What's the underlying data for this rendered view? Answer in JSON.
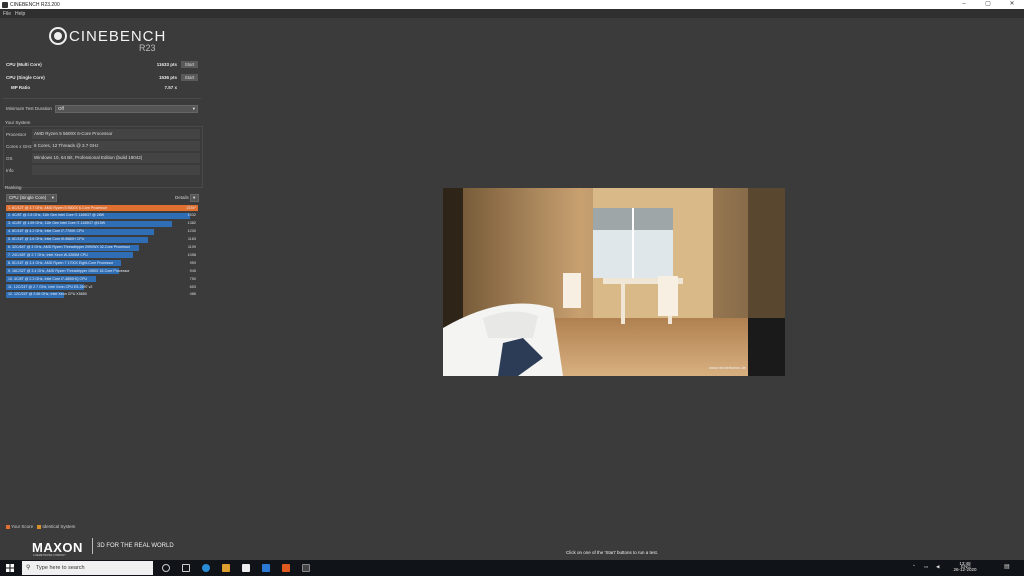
{
  "window": {
    "title": "CINEBENCH R23.200",
    "min": "–",
    "max": "▢",
    "close": "✕"
  },
  "menu": {
    "file": "File",
    "help": "Help"
  },
  "logo": {
    "name": "CINEBENCH",
    "version": "R23"
  },
  "scores": {
    "multi_label": "CPU (Multi Core)",
    "multi_value": "11633 pts",
    "single_label": "CPU (Single Core)",
    "single_value": "1536 pts",
    "ratio_label": "MP Ratio",
    "ratio_value": "7.57 x",
    "start_label": "Start"
  },
  "test_duration": {
    "label": "Minimum Test Duration",
    "value": "Off"
  },
  "system": {
    "heading": "Your System",
    "rows": [
      {
        "label": "Processor",
        "value": "AMD Ryzen 5 5600X 6-Core Processor"
      },
      {
        "label": "Cores x GHz",
        "value": "6 Cores, 12 Threads @ 3.7 GHz"
      },
      {
        "label": "OS",
        "value": "Windows 10, 64 Bit, Professional Edition (build 19042)"
      },
      {
        "label": "Info",
        "value": ""
      }
    ]
  },
  "ranking": {
    "heading": "Ranking",
    "selector": "CPU (Single Core)",
    "details": "Details",
    "max": 1600,
    "rows": [
      {
        "label": "1. 6C/12T @ 3.7 GHz, AMD Ryzen 5 5600X 6-Core Processor",
        "value": "1536*",
        "score": 1536,
        "mine": true
      },
      {
        "label": "2. 4C/8T @ 2.8 GHz, 11th Gen Intel Core i7-1165G7 @ 28W",
        "value": "1532",
        "score": 1532
      },
      {
        "label": "3. 4C/8T @ 1.69 GHz, 11th Gen Intel Core i7-1165G7 @15W",
        "value": "1382",
        "score": 1382
      },
      {
        "label": "4. 8C/16T @ 4.2 GHz, Intel Core i7-7700K CPU",
        "value": "1230",
        "score": 1230
      },
      {
        "label": "5. 8C/16T @ 3.6 GHz, Intel Core i9-9880H CPU",
        "value": "1183",
        "score": 1183
      },
      {
        "label": "6. 32C/64T @ 3 GHz, AMD Ryzen Threadripper 2990WX 32-Core Processor",
        "value": "1109",
        "score": 1109
      },
      {
        "label": "7. 24C/48T @ 2.7 GHz, Intel Xeon W-3265M CPU",
        "value": "1058",
        "score": 1058
      },
      {
        "label": "8. 8C/16T @ 3.4 GHz, AMD Ryzen 7 1700X Eight-Core Processor",
        "value": "959",
        "score": 959
      },
      {
        "label": "9. 16C/32T @ 3.4 GHz, AMD Ryzen Threadripper 1950X 16-Core Processor",
        "value": "945",
        "score": 945
      },
      {
        "label": "10. 4C/8T @ 2.3 GHz, Intel Core i7-4850HQ CPU",
        "value": "750",
        "score": 750
      },
      {
        "label": "11. 12C/24T @ 2.7 GHz, Intel Xeon CPU E5-2697 v2",
        "value": "653",
        "score": 653
      },
      {
        "label": "12. 12C/24T @ 2.66 GHz, Intel Xeon CPU X5650",
        "value": "486",
        "score": 486
      }
    ]
  },
  "legend": {
    "your_score": "Your Score",
    "identical": "Identical System"
  },
  "footer": {
    "brand": "MAXON",
    "brand_sub": "A NEMETSCHEK COMPANY",
    "tagline": "3D FOR THE REAL WORLD",
    "hint": "Click on one of the 'Start' buttons to run a test."
  },
  "render": {
    "watermark": "www.renderbaron.de"
  },
  "taskbar": {
    "search_placeholder": "Type here to search",
    "lang": "ENG",
    "time": "13:48",
    "date": "26-12-2020"
  },
  "colors": {
    "accent_orange": "#e07030",
    "bar_blue": "#2f6db5",
    "bg": "#3b3b3b"
  }
}
